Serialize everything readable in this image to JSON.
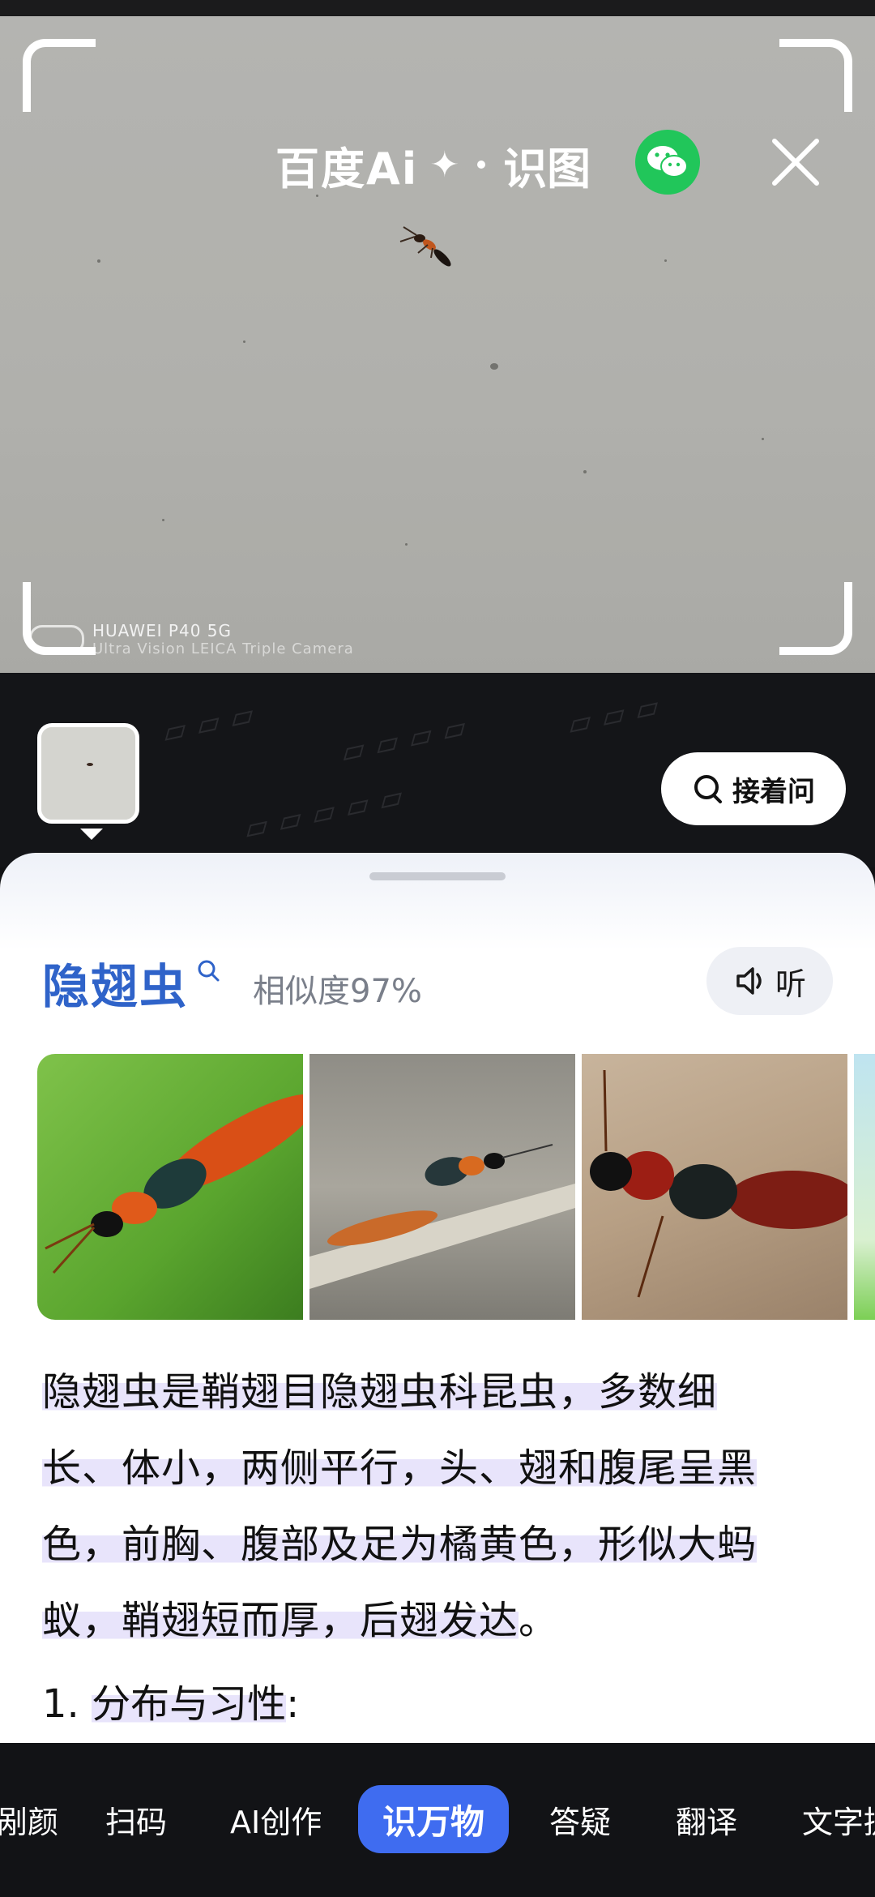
{
  "header": {
    "brand": "百度Ai",
    "brand_star": "✦",
    "suffix": "识图"
  },
  "photo": {
    "watermark_line1": "HUAWEI P40 5G",
    "watermark_line2": "Ultra Vision LEICA Triple Camera"
  },
  "actions": {
    "follow_up_label": "接着问",
    "listen_label": "听"
  },
  "result": {
    "name": "隐翅虫",
    "similarity": "相似度97%",
    "description": [
      "隐翅虫是鞘翅目隐翅虫科昆虫，多数细",
      "长、体小，两侧平行，头、翅和腹尾呈黑",
      "色，前胸、腹部及足为橘黄色，形似大蚂",
      "蚁，鞘翅短而厚，后翅发达"
    ],
    "description_end": "。",
    "section_number": "1.",
    "section_title": "分布与习性",
    "section_colon": ":"
  },
  "modes": [
    "剐颜",
    "扫码",
    "AI创作",
    "识万物",
    "答疑",
    "翻译",
    "文字提"
  ],
  "active_mode": "识万物",
  "colors": {
    "accent": "#3f6cf0",
    "species_name": "#2f63c9",
    "wechat_green": "#21c65a",
    "highlight": "#e8e4fb"
  },
  "icons": [
    "wechat-icon",
    "close-icon",
    "search-icon",
    "speaker-icon"
  ]
}
